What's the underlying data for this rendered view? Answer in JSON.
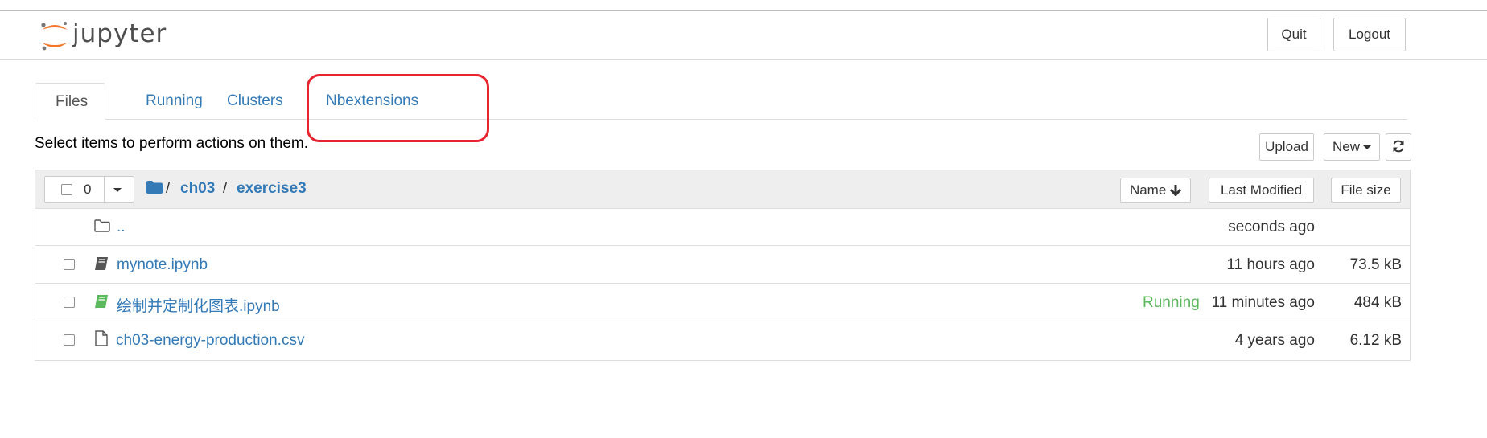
{
  "header": {
    "logo_text": "jupyter",
    "quit_label": "Quit",
    "logout_label": "Logout"
  },
  "tabs": [
    {
      "label": "Files",
      "active": true
    },
    {
      "label": "Running",
      "active": false
    },
    {
      "label": "Clusters",
      "active": false
    },
    {
      "label": "Nbextensions",
      "active": false
    }
  ],
  "toolbar": {
    "hint": "Select items to perform actions on them.",
    "upload_label": "Upload",
    "new_label": "New",
    "refresh_icon": "refresh-icon"
  },
  "list_header": {
    "selected_count": "0",
    "breadcrumb": [
      "ch03",
      "exercise3"
    ],
    "breadcrumb_sep": "/",
    "sort_name_label": "Name",
    "sort_modified_label": "Last Modified",
    "sort_size_label": "File size"
  },
  "rows": [
    {
      "icon": "folder-icon",
      "name": "..",
      "status": "",
      "modified": "seconds ago",
      "size": ""
    },
    {
      "icon": "notebook-icon",
      "name": "mynote.ipynb",
      "status": "",
      "modified": "11 hours ago",
      "size": "73.5 kB"
    },
    {
      "icon": "notebook-running-icon",
      "name": "绘制并定制化图表.ipynb",
      "status": "Running",
      "modified": "11 minutes ago",
      "size": "484 kB"
    },
    {
      "icon": "file-icon",
      "name": "ch03-energy-production.csv",
      "status": "",
      "modified": "4 years ago",
      "size": "6.12 kB"
    }
  ],
  "colors": {
    "link": "#337ab7",
    "running": "#5cb85c",
    "highlight": "#e8242e",
    "logo_orange": "#f37726"
  }
}
